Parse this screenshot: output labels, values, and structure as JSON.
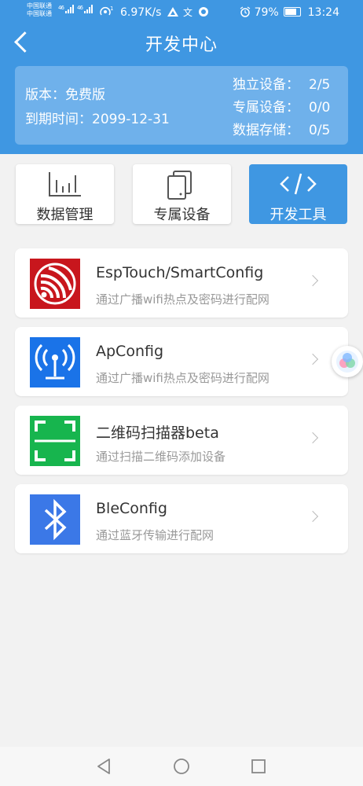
{
  "status_bar": {
    "carrier1": "中国联通",
    "carrier2": "中国联通",
    "net1": "46",
    "net2": "46",
    "speed": "6.97K/s",
    "battery": "79%",
    "time": "13:24"
  },
  "header": {
    "title": "开发中心"
  },
  "info": {
    "version_label": "版本：",
    "version_value": "免费版",
    "expire_label": "到期时间：",
    "expire_value": "2099-12-31",
    "stats": [
      {
        "label": "独立设备：",
        "value": "2/5"
      },
      {
        "label": "专属设备：",
        "value": "0/0"
      },
      {
        "label": "数据存储：",
        "value": "0/5"
      }
    ]
  },
  "tabs": [
    {
      "label": "数据管理",
      "icon": "bar-chart-icon",
      "active": false
    },
    {
      "label": "专属设备",
      "icon": "devices-icon",
      "active": false
    },
    {
      "label": "开发工具",
      "icon": "code-icon",
      "active": true
    }
  ],
  "tools": [
    {
      "title": "EspTouch/SmartConfig",
      "subtitle": "通过广播wifi热点及密码进行配网",
      "icon": "espressif-logo-icon",
      "color": "#c8161d"
    },
    {
      "title": "ApConfig",
      "subtitle": "通过广播wifi热点及密码进行配网",
      "icon": "antenna-icon",
      "color": "#1a73e8"
    },
    {
      "title": "二维码扫描器beta",
      "subtitle": "通过扫描二维码添加设备",
      "icon": "qr-scan-icon",
      "color": "#17b54e"
    },
    {
      "title": "BleConfig",
      "subtitle": "通过蓝牙传输进行配网",
      "icon": "bluetooth-icon",
      "color": "#3b78e7"
    }
  ],
  "colors": {
    "primary": "#3f97e2",
    "info_card": "#6fb1eb",
    "background": "#f2f2f2"
  }
}
